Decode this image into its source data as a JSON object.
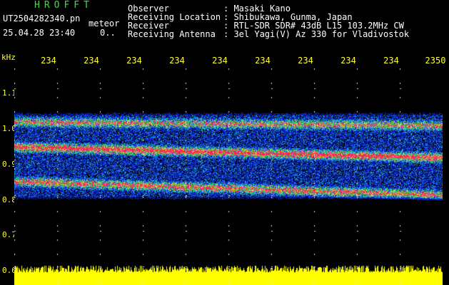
{
  "header": {
    "app_title": "HROFFT",
    "file_name": "UT2504282340.pn",
    "file_mode": "meteor",
    "file_time": "25.04.28 23:40",
    "file_extra": "0..",
    "info": [
      {
        "label": "Observer",
        "value": ": Masaki Kano"
      },
      {
        "label": "Receiving Location",
        "value": ": Shibukawa, Gunma, Japan"
      },
      {
        "label": "Receiver",
        "value": ": RTL-SDR SDR# 43dB L15 103.2MHz CW"
      },
      {
        "label": "Receiving Antenna",
        "value": ": 3el Yagi(V) Az 330 for Vladivostok"
      }
    ]
  },
  "axes": {
    "y_unit": "kHz",
    "y_ticks": [
      "1.1",
      "1.0",
      "0.9",
      "0.8",
      "0.7",
      "0.6"
    ],
    "time_ticks": [
      "234",
      "234",
      "234",
      "234",
      "234",
      "234",
      "234",
      "234",
      "234",
      "2350"
    ]
  },
  "spectrogram": {
    "y_range_khz": [
      0.6,
      1.15
    ],
    "noise_band_khz": [
      0.785,
      1.035
    ],
    "carrier_lines": [
      {
        "start_khz": 1.005,
        "end_khz": 0.995,
        "strength": 0.75
      },
      {
        "start_khz": 0.935,
        "end_khz": 0.905,
        "strength": 1.0
      },
      {
        "start_khz": 0.838,
        "end_khz": 0.8,
        "strength": 0.85
      }
    ],
    "background_color": "#000000",
    "low_color": "#0a1cc8",
    "mid_color": "#2fd84a",
    "high_color": "#ff1e5a",
    "power_strip_color": "#ffff00"
  }
}
